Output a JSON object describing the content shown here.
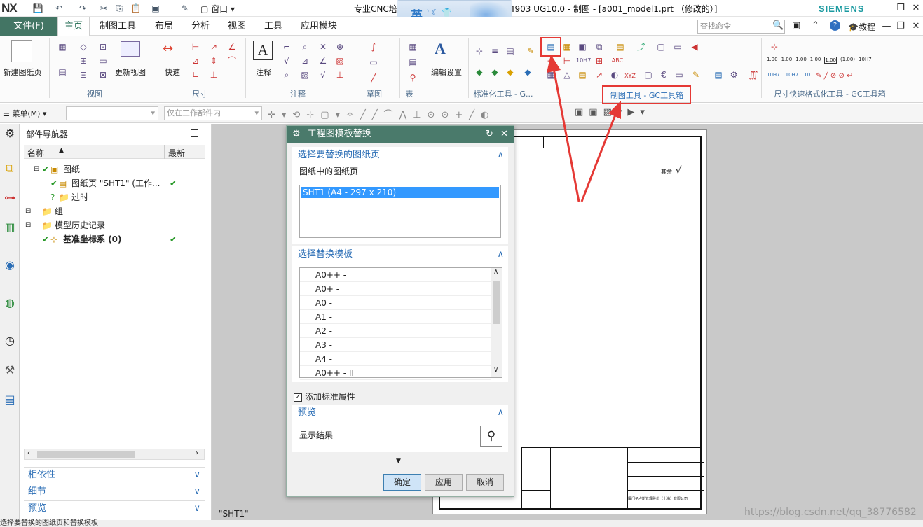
{
  "title_bar": {
    "logo": "NX",
    "window_menu": "窗口",
    "title_left": "专业CNC培",
    "title_right": "4324903 UG10.0 - 制图 - [a001_model1.prt （修改的）]",
    "brand": "SIEMENS",
    "ime_label": "英"
  },
  "menu_bar": {
    "file": "文件(F)",
    "tabs": [
      "主页",
      "制图工具",
      "布局",
      "分析",
      "视图",
      "工具",
      "应用模块"
    ],
    "search_placeholder": "查找命令",
    "tutorial": "教程"
  },
  "ribbon": {
    "new_sheet": "新建图纸页",
    "update_view": "更新视图",
    "quick": "快速",
    "note": "注释",
    "edit_settings": "编辑设置",
    "groups": {
      "view": "视图",
      "dimension": "尺寸",
      "annotation": "注释",
      "sketch": "草图",
      "table": "表",
      "std_tools": "标准化工具 - G...",
      "gc_toolbox": "制图工具 - GC工具箱",
      "dim_format": "尺寸快速格式化工具 - GC工具箱"
    },
    "tol_labels": [
      "1.00",
      "1.00",
      "1.00",
      "1.00",
      "1.00",
      "(1.00)",
      "10H7",
      "10H7",
      "10H7",
      "10"
    ]
  },
  "toolbar2": {
    "menu": "菜单(M)",
    "filter": "仅在工作部件内"
  },
  "navigator": {
    "title": "部件导航器",
    "col_name": "名称",
    "col_latest": "最新",
    "rows": [
      {
        "label": "图纸",
        "indent": 1,
        "latest": ""
      },
      {
        "label": "图纸页 \"SHT1\" (工作...",
        "indent": 2,
        "latest": "✔"
      },
      {
        "label": "过时",
        "indent": 2,
        "latest": ""
      },
      {
        "label": "组",
        "indent": 0,
        "latest": ""
      },
      {
        "label": "模型历史记录",
        "indent": 0,
        "latest": ""
      },
      {
        "label": "基准坐标系 (0)",
        "indent": 1,
        "latest": "✔"
      }
    ],
    "panels": [
      "相依性",
      "细节",
      "预览"
    ]
  },
  "dialog": {
    "title": "工程图模板替换",
    "sec1": "选择要替换的图纸页",
    "sheets_label": "图纸中的图纸页",
    "sheet_item": "SHT1 (A4 - 297 x 210)",
    "sec2": "选择替换模板",
    "templates": [
      "A0++ -",
      "A0+ -",
      "A0 -",
      "A1 -",
      "A2 -",
      "A3 -",
      "A4 -",
      "A0++ - II"
    ],
    "add_attr": "添加标准属性",
    "sec3": "预览",
    "show_result": "显示结果",
    "ok": "确定",
    "apply": "应用",
    "cancel": "取消"
  },
  "canvas": {
    "sheet_name": "\"SHT1\"",
    "roughness": "其余",
    "company": "厦门子卢斯管理股份（上海）有限公司",
    "watermark": "https://blog.csdn.net/qq_38776582"
  },
  "status": {
    "text": "选择要替换的图纸页和替换模板"
  },
  "colors": {
    "accent": "#437564",
    "highlight": "#e53935",
    "selected": "#3399ff"
  }
}
